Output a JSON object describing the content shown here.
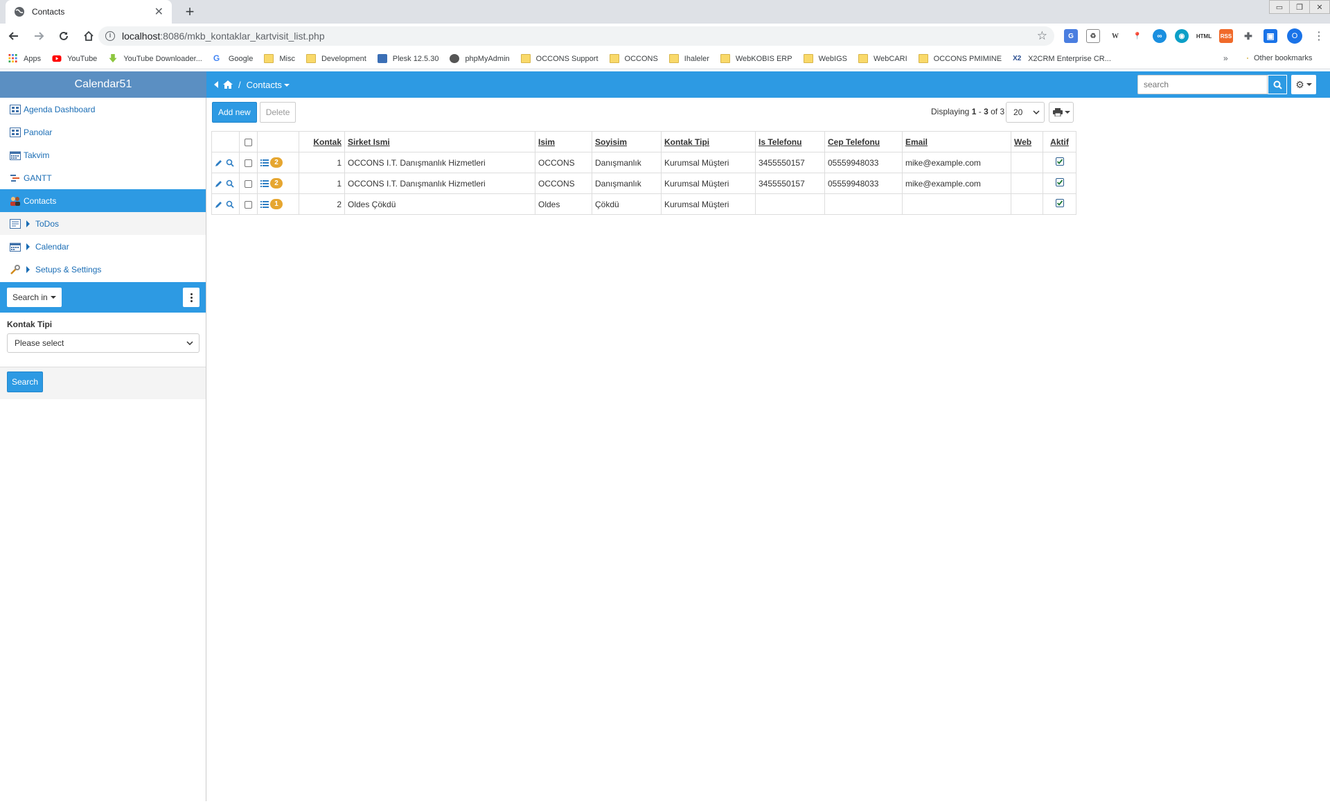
{
  "browser": {
    "tab_title": "Contacts",
    "url_host": "localhost",
    "url_path": ":8086/mkb_kontaklar_kartvisit_list.php",
    "profile_initial": "O",
    "bookmarks": [
      "Apps",
      "YouTube",
      "YouTube Downloader...",
      "Google",
      "Misc",
      "Development",
      "Plesk 12.5.30",
      "phpMyAdmin",
      "OCCONS Support",
      "OCCONS",
      "Ihaleler",
      "WebKOBIS ERP",
      "WebIGS",
      "WebCARI",
      "OCCONS PMIMINE",
      "X2CRM Enterprise CR..."
    ],
    "other_bookmarks": "Other bookmarks",
    "more": "»"
  },
  "app": {
    "brand": "Calendar51",
    "breadcrumb_current": "Contacts",
    "search_placeholder": "search"
  },
  "sidebar": {
    "items": [
      {
        "label": "Agenda Dashboard",
        "icon": "dashboard-icon"
      },
      {
        "label": "Panolar",
        "icon": "dashboard-icon"
      },
      {
        "label": "Takvim",
        "icon": "calendar-icon"
      },
      {
        "label": "GANTT",
        "icon": "gantt-icon"
      },
      {
        "label": "Contacts",
        "icon": "contacts-icon"
      },
      {
        "label": "ToDos",
        "icon": "todo-icon"
      },
      {
        "label": "Calendar",
        "icon": "calendar-icon"
      },
      {
        "label": "Setups & Settings",
        "icon": "wrench-icon"
      }
    ],
    "search_in": "Search in",
    "filter_label": "Kontak Tipi",
    "filter_value": "Please select",
    "search_button": "Search"
  },
  "main": {
    "add_new": "Add new",
    "delete": "Delete",
    "displaying_prefix": "Displaying ",
    "displaying_from": "1",
    "displaying_sep": " - ",
    "displaying_to": "3",
    "displaying_of": " of ",
    "displaying_total": "3",
    "page_size": "20",
    "columns": [
      "Kontak",
      "Sirket Ismi",
      "Isim",
      "Soyisim",
      "Kontak Tipi",
      "Is Telefonu",
      "Cep Telefonu",
      "Email",
      "Web",
      "Aktif"
    ],
    "rows": [
      {
        "badge": "2",
        "kontak": "1",
        "sirket": "OCCONS I.T. Danışmanlık Hizmetleri",
        "isim": "OCCONS",
        "soyisim": "Danışmanlık",
        "tipi": "Kurumsal Müşteri",
        "is_tel": "3455550157",
        "cep_tel": "05559948033",
        "email": "mike@example.com",
        "web": "",
        "aktif": true
      },
      {
        "badge": "2",
        "kontak": "1",
        "sirket": "OCCONS I.T. Danışmanlık Hizmetleri",
        "isim": "OCCONS",
        "soyisim": "Danışmanlık",
        "tipi": "Kurumsal Müşteri",
        "is_tel": "3455550157",
        "cep_tel": "05559948033",
        "email": "mike@example.com",
        "web": "",
        "aktif": true
      },
      {
        "badge": "1",
        "kontak": "2",
        "sirket": "Oldes Çökdü",
        "isim": "Oldes",
        "soyisim": "Çökdü",
        "tipi": "Kurumsal Müşteri",
        "is_tel": "",
        "cep_tel": "",
        "email": "",
        "web": "",
        "aktif": true
      }
    ]
  }
}
